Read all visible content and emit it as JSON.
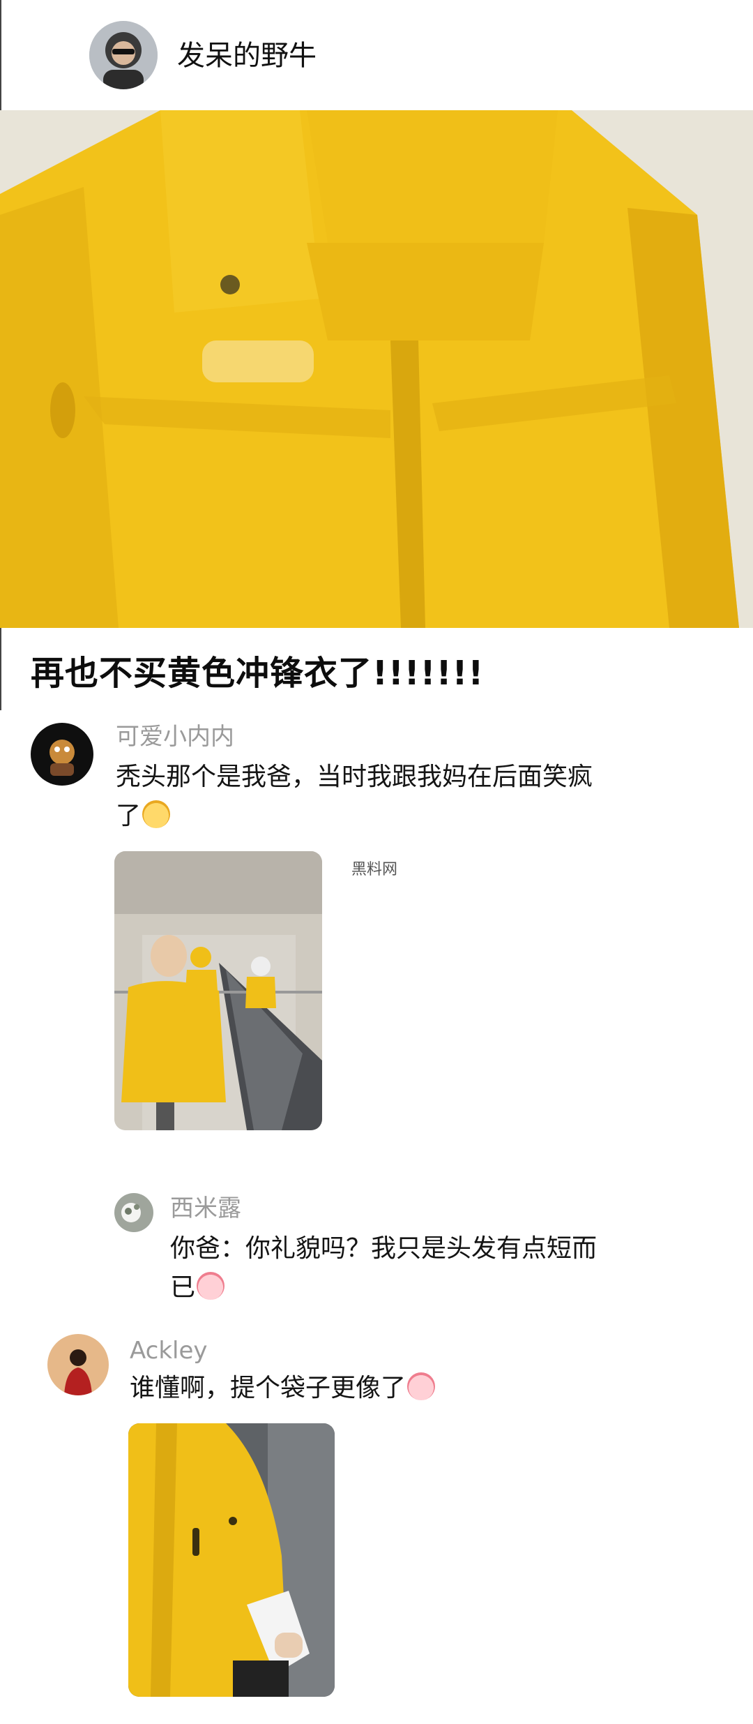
{
  "post": {
    "author_name": "发呆的野牛",
    "title": "再也不买黄色冲锋衣了!!!!!!!"
  },
  "watermark": "黑料网",
  "comments": [
    {
      "name": "可爱小内内",
      "text": "秃头那个是我爸，当时我跟我妈在后面笑疯了",
      "emoji": "smiling-face-emoji"
    },
    {
      "name": "西米露",
      "text": "你爸：你礼貌吗？我只是头发有点短而已",
      "emoji": "crying-face-emoji"
    },
    {
      "name": "Ackley",
      "text": "谁懂啊，提个袋子更像了",
      "emoji": "crying-face-emoji"
    }
  ],
  "colors": {
    "jacket_yellow": "#f2c21a",
    "name_gray": "#9a9a9a",
    "text_black": "#141414"
  }
}
